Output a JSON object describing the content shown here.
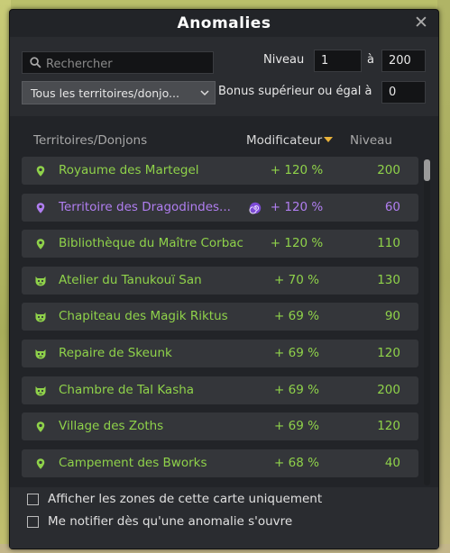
{
  "window": {
    "title": "Anomalies"
  },
  "search": {
    "placeholder": "Rechercher"
  },
  "filters": {
    "territory_dropdown": "Tous les territoires/donjo...",
    "level_label": "Niveau",
    "level_min": "1",
    "level_to_label": "à",
    "level_max": "200",
    "bonus_label": "Bonus supérieur ou égal à",
    "bonus_value": "0"
  },
  "table": {
    "headers": {
      "name": "Territoires/Donjons",
      "modifier": "Modificateur",
      "level": "Niveau"
    },
    "rows": [
      {
        "icon": "map-pin-icon",
        "name": "Royaume des Martegel",
        "modifier": "+ 120 %",
        "level": "200",
        "color": "#8fd24a"
      },
      {
        "icon": "map-pin-icon",
        "name": "Territoire des Dragodindes...",
        "modifier": "+ 120 %",
        "level": "60",
        "color": "#b07ef0",
        "extra_icon": "spiral-icon"
      },
      {
        "icon": "map-pin-icon",
        "name": "Bibliothèque du Maître Corbac",
        "modifier": "+ 120 %",
        "level": "110",
        "color": "#8fd24a"
      },
      {
        "icon": "monster-icon",
        "name": "Atelier du Tanukouï San",
        "modifier": "+ 70 %",
        "level": "130",
        "color": "#8fd24a"
      },
      {
        "icon": "monster-icon",
        "name": "Chapiteau des Magik Riktus",
        "modifier": "+ 69 %",
        "level": "90",
        "color": "#8fd24a"
      },
      {
        "icon": "monster-icon",
        "name": "Repaire de Skeunk",
        "modifier": "+ 69 %",
        "level": "120",
        "color": "#8fd24a"
      },
      {
        "icon": "monster-icon",
        "name": "Chambre de Tal Kasha",
        "modifier": "+ 69 %",
        "level": "200",
        "color": "#8fd24a"
      },
      {
        "icon": "map-pin-icon",
        "name": "Village des Zoths",
        "modifier": "+ 69 %",
        "level": "120",
        "color": "#8fd24a"
      },
      {
        "icon": "map-pin-icon",
        "name": "Campement des Bworks",
        "modifier": "+ 68 %",
        "level": "40",
        "color": "#8fd24a"
      }
    ]
  },
  "options": {
    "only_this_map": "Afficher les zones de cette carte uniquement",
    "notify": "Me notifier dès qu'une anomalie s'ouvre"
  }
}
